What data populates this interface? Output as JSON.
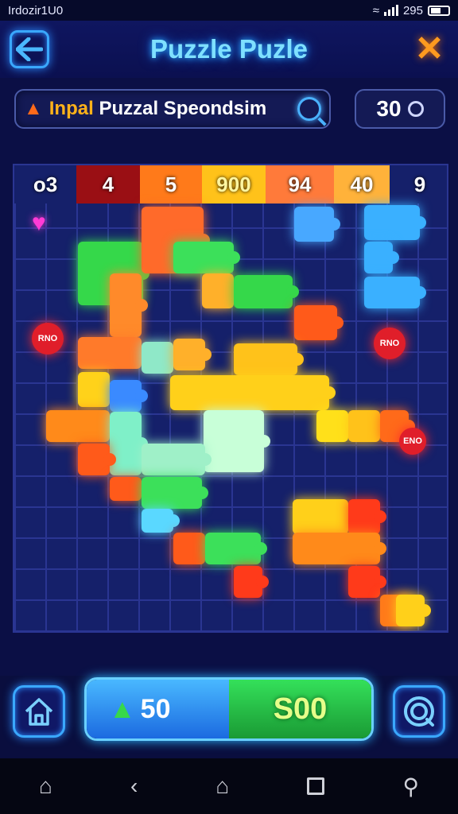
{
  "status_bar": {
    "left_text": "Irdozir1U0",
    "right_text": "295"
  },
  "header": {
    "title": "Puzzle Puzle"
  },
  "search": {
    "text_prefix": "Inpal",
    "text_rest": "Puzzal Speondsim"
  },
  "score": {
    "value": "30"
  },
  "board": {
    "header_cells": [
      {
        "label": "o3",
        "color": "#15206a"
      },
      {
        "label": "4",
        "color": "#9a0f14"
      },
      {
        "label": "5",
        "color": "#ff7a1a"
      },
      {
        "label": "900",
        "color": "#ffc21a"
      },
      {
        "label": "94",
        "color": "#ff7a3a"
      },
      {
        "label": "40",
        "color": "#ffb23a"
      },
      {
        "label": "9",
        "color": "#15206a"
      }
    ],
    "splat_labels": [
      "RNO",
      "RNO",
      "ENO"
    ]
  },
  "bottom": {
    "left_value": "50",
    "right_value": "S00",
    "progress_fraction": 0.5
  },
  "colors": {
    "accent_blue": "#3aa8ff",
    "accent_orange": "#ff9a1f",
    "board_bg": "#15206a"
  }
}
